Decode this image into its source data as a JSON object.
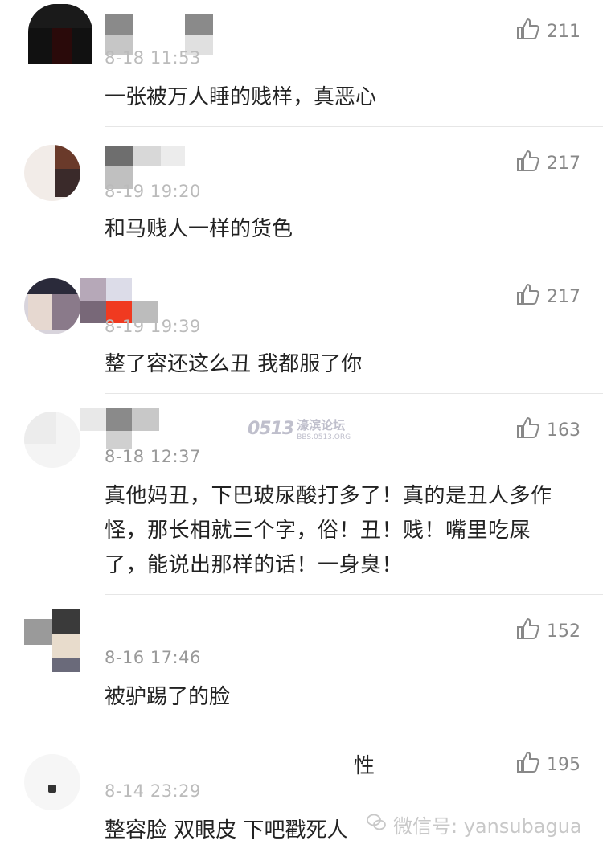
{
  "comments": [
    {
      "time": "8-18 11:53",
      "text": "一张被万人睡的贱样，真恶心",
      "likes": "211"
    },
    {
      "time": "8-19 19:20",
      "text": "和马贱人一样的货色",
      "likes": "217"
    },
    {
      "time": "8-19 19:39",
      "text": "整了容还这么丑 我都服了你",
      "likes": "217"
    },
    {
      "time": "8-18 12:37",
      "text": "真他妈丑，下巴玻尿酸打多了！真的是丑人多作怪，那长相就三个字，俗！丑！贱！嘴里吃屎了，能说出那样的话！一身臭！",
      "likes": "163"
    },
    {
      "time": "8-16 17:46",
      "text": "被驴踢了的脸",
      "likes": "152"
    },
    {
      "time": "8-14 23:29",
      "text": "整容脸 双眼皮 下吧戳死人",
      "likes": "195",
      "name_fragment": "性"
    }
  ],
  "watermarks": {
    "forum_logo": "0513",
    "forum_name": "濠滨论坛",
    "forum_url": "BBS.0513.ORG",
    "wechat": "微信号: yansubagua"
  },
  "icons": {
    "like": "thumbs-up-icon",
    "wechat": "wechat-icon"
  },
  "colors": {
    "text": "#222222",
    "meta": "#999999",
    "like": "#888888",
    "divider": "#e6e6e6"
  }
}
